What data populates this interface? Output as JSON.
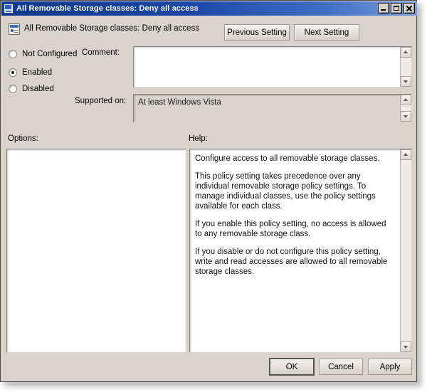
{
  "window": {
    "title": "All Removable Storage classes: Deny all access",
    "title_icon": "policy-window-icon",
    "controls": {
      "minimize": "minimize-icon",
      "maximize": "maximize-icon",
      "close": "close-icon"
    }
  },
  "header": {
    "icon": "policy-setting-icon",
    "setting_name": "All Removable Storage classes: Deny all access",
    "previous_button": "Previous Setting",
    "next_button": "Next Setting"
  },
  "state": {
    "options": [
      {
        "label": "Not Configured",
        "selected": false
      },
      {
        "label": "Enabled",
        "selected": true
      },
      {
        "label": "Disabled",
        "selected": false
      }
    ]
  },
  "fields": {
    "comment_label": "Comment:",
    "comment_value": "",
    "supported_label": "Supported on:",
    "supported_value": "At least Windows Vista"
  },
  "panes": {
    "options_label": "Options:",
    "options_content": "",
    "help_label": "Help:",
    "help_paragraphs": [
      "Configure access to all removable storage classes.",
      "This policy setting takes precedence over any individual removable storage policy settings. To manage individual classes, use the policy settings available for each class.",
      "If you enable this policy setting, no access is allowed to any removable storage class.",
      "If you disable or do not configure this policy setting, write and read accesses are allowed to all removable storage classes."
    ]
  },
  "footer": {
    "ok": "OK",
    "cancel": "Cancel",
    "apply": "Apply"
  },
  "colors": {
    "dialog_background": "#d8d4cc",
    "titlebar_start": "#123a8f",
    "titlebar_end": "#7c9ed8",
    "field_background": "#ffffff",
    "text": "#000000"
  }
}
